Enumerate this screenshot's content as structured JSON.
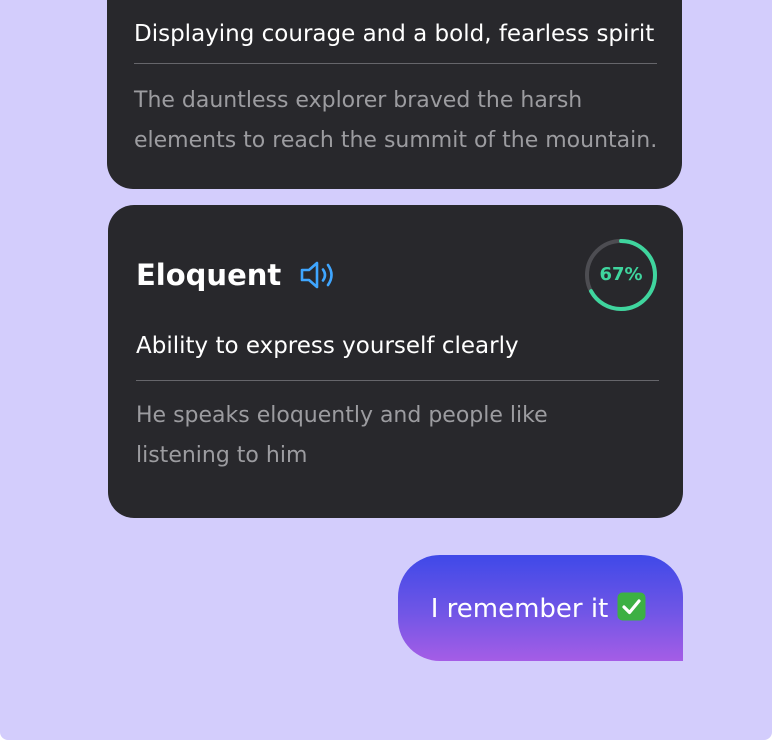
{
  "prev_card": {
    "definition": "Displaying courage and a bold, fearless spirit",
    "example_line1": "The dauntless explorer braved the harsh",
    "example_line2": "elements to reach the summit of the mountain."
  },
  "card": {
    "word": "Eloquent",
    "speaker_icon": "speaker-icon",
    "progress_percent": 67,
    "progress_label": "67%",
    "definition": "Ability to express yourself clearly",
    "example_line1": "He speaks eloquently and people like",
    "example_line2": "listening to him"
  },
  "reply": {
    "text": "I remember it",
    "icon": "check-mark-icon"
  },
  "colors": {
    "background": "#d3cdfc",
    "card": "#28282c",
    "accent_blue": "#3fa6ff",
    "progress_green": "#3fd59e",
    "bubble_top": "#3f49e8",
    "bubble_bottom": "#a55de6"
  }
}
